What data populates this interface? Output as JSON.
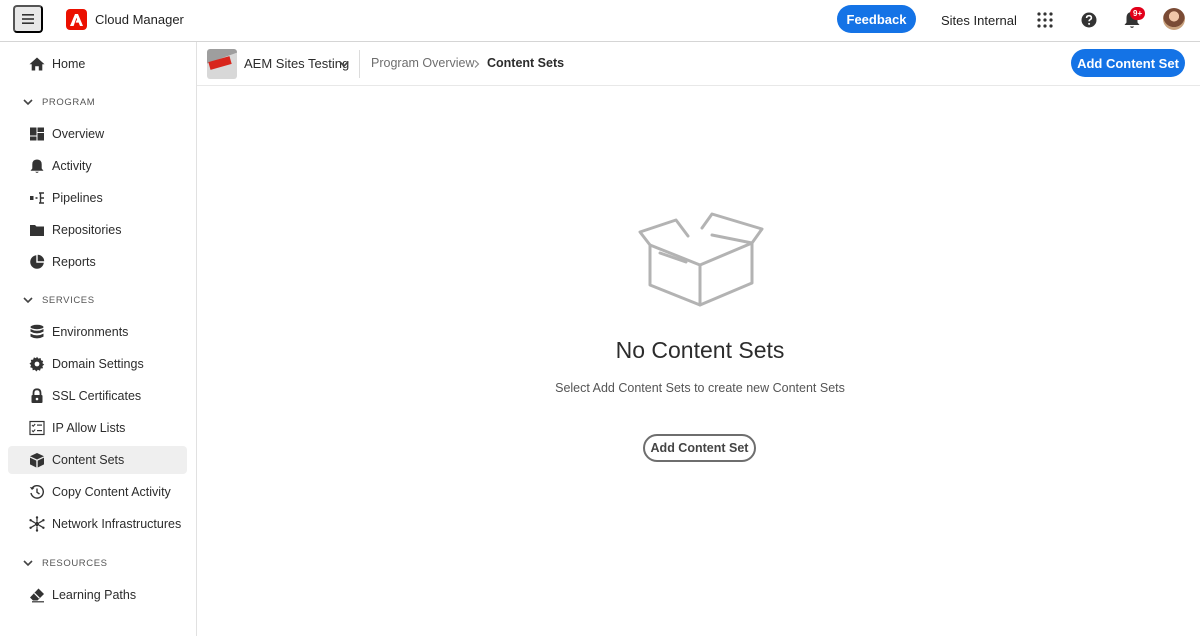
{
  "app": {
    "title": "Cloud Manager"
  },
  "topbar": {
    "feedback_label": "Feedback",
    "org_name": "Sites Internal",
    "notification_count": "9+"
  },
  "sidebar": {
    "home": "Home",
    "sections": {
      "program": "PROGRAM",
      "services": "SERVICES",
      "resources": "RESOURCES"
    },
    "program_items": [
      "Overview",
      "Activity",
      "Pipelines",
      "Repositories",
      "Reports"
    ],
    "service_items": [
      "Environments",
      "Domain Settings",
      "SSL Certificates",
      "IP Allow Lists",
      "Content Sets",
      "Copy Content Activity",
      "Network Infrastructures"
    ],
    "resource_items": [
      "Learning Paths"
    ],
    "selected": "Content Sets"
  },
  "header": {
    "program_name": "AEM Sites Testing",
    "breadcrumb": [
      "Program Overview",
      "Content Sets"
    ],
    "add_button_label": "Add Content Set"
  },
  "empty_state": {
    "title": "No Content Sets",
    "description": "Select Add Content Sets to create new Content Sets",
    "button_label": "Add Content Set"
  },
  "colors": {
    "accent": "#1473e6",
    "adobe_red": "#eb1000",
    "badge_red": "#e2001a"
  }
}
